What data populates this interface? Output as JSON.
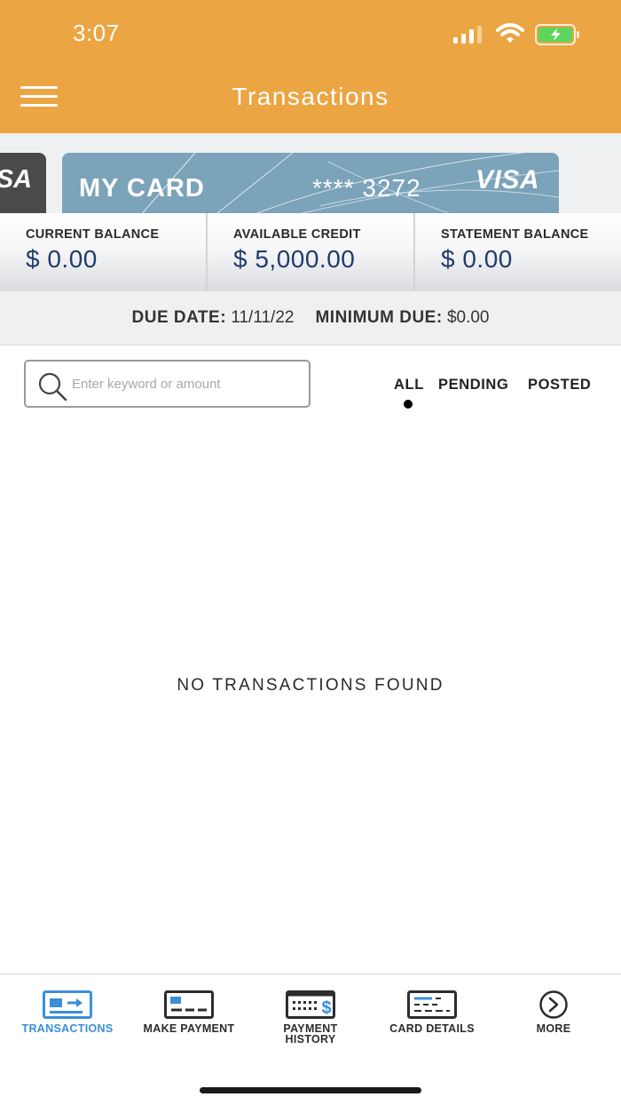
{
  "status_bar": {
    "time": "3:07"
  },
  "header": {
    "title": "Transactions"
  },
  "cards": {
    "previous_brand": "SA",
    "current": {
      "name": "MY CARD",
      "number_masked": "**** 3272",
      "brand": "VISA"
    }
  },
  "balances": [
    {
      "label": "CURRENT BALANCE",
      "value": "$ 0.00"
    },
    {
      "label": "AVAILABLE CREDIT",
      "value": "$ 5,000.00"
    },
    {
      "label": "STATEMENT BALANCE",
      "value": "$ 0.00"
    }
  ],
  "due": {
    "due_date_label": "DUE DATE:",
    "due_date": "11/11/22",
    "minimum_label": "MINIMUM DUE:",
    "minimum": "$0.00"
  },
  "search": {
    "placeholder": "Enter keyword or amount",
    "value": ""
  },
  "filters": {
    "all": "ALL",
    "pending": "PENDING",
    "posted": "POSTED",
    "active": "all"
  },
  "empty_message": "NO TRANSACTIONS FOUND",
  "tabbar": {
    "items": [
      {
        "label": "TRANSACTIONS",
        "icon": "transactions-icon",
        "active": true
      },
      {
        "label": "MAKE PAYMENT",
        "icon": "make-payment-icon"
      },
      {
        "label": "PAYMENT\nHISTORY",
        "icon": "payment-history-icon"
      },
      {
        "label": "CARD DETAILS",
        "icon": "card-details-icon"
      },
      {
        "label": "MORE",
        "icon": "more-icon"
      }
    ]
  },
  "colors": {
    "header": "#EBA542",
    "accent": "#3A8FD8",
    "balance_value": "#1F3C6E",
    "card": "#7BA3BA"
  }
}
